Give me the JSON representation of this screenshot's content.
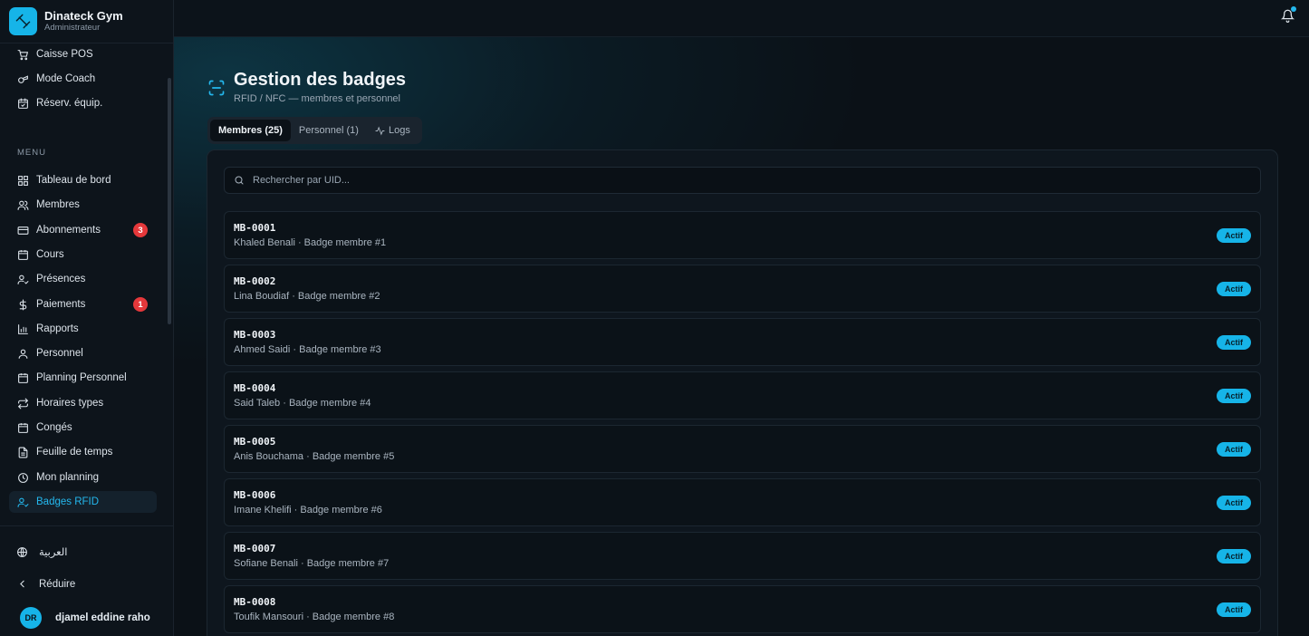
{
  "brand": {
    "name": "Dinateck Gym",
    "role": "Administrateur"
  },
  "sidebar": {
    "quick_items": [
      {
        "label": "Caisse POS",
        "icon": "cart-icon"
      },
      {
        "label": "Mode Coach",
        "icon": "whistle-icon"
      },
      {
        "label": "Réserv. équip.",
        "icon": "calendar-check-icon"
      }
    ],
    "menu_heading": "MENU",
    "items": [
      {
        "label": "Tableau de bord",
        "icon": "dashboard-icon"
      },
      {
        "label": "Membres",
        "icon": "users-icon"
      },
      {
        "label": "Abonnements",
        "icon": "card-icon",
        "badge": "3"
      },
      {
        "label": "Cours",
        "icon": "calendar-icon"
      },
      {
        "label": "Présences",
        "icon": "user-check-icon"
      },
      {
        "label": "Paiements",
        "icon": "dollar-icon",
        "badge": "1"
      },
      {
        "label": "Rapports",
        "icon": "bar-chart-icon"
      },
      {
        "label": "Personnel",
        "icon": "user-icon"
      },
      {
        "label": "Planning Personnel",
        "icon": "calendar-icon"
      },
      {
        "label": "Horaires types",
        "icon": "repeat-icon"
      },
      {
        "label": "Congés",
        "icon": "calendar-icon"
      },
      {
        "label": "Feuille de temps",
        "icon": "file-icon"
      },
      {
        "label": "Mon planning",
        "icon": "clock-icon"
      },
      {
        "label": "Badges RFID",
        "icon": "user-badge-icon",
        "active": true
      }
    ],
    "language_label": "العربية",
    "collapse_label": "Réduire",
    "user": {
      "initials": "DR",
      "name": "djamel eddine raho"
    }
  },
  "colors": {
    "accent": "#16b4e8",
    "badge_alert": "#e5383b",
    "background": "#0b1117"
  },
  "page": {
    "title": "Gestion des badges",
    "subtitle": "RFID / NFC — membres et personnel",
    "tabs": [
      {
        "label": "Membres (25)",
        "active": true
      },
      {
        "label": "Personnel (1)"
      },
      {
        "label": "Logs",
        "icon": "activity-icon"
      }
    ],
    "search": {
      "placeholder": "Rechercher par UID...",
      "value": ""
    },
    "badges": [
      {
        "code": "MB-0001",
        "desc": "Khaled Benali · Badge membre #1",
        "status": "Actif"
      },
      {
        "code": "MB-0002",
        "desc": "Lina Boudiaf · Badge membre #2",
        "status": "Actif"
      },
      {
        "code": "MB-0003",
        "desc": "Ahmed Saidi · Badge membre #3",
        "status": "Actif"
      },
      {
        "code": "MB-0004",
        "desc": "Said Taleb · Badge membre #4",
        "status": "Actif"
      },
      {
        "code": "MB-0005",
        "desc": "Anis Bouchama · Badge membre #5",
        "status": "Actif"
      },
      {
        "code": "MB-0006",
        "desc": "Imane Khelifi · Badge membre #6",
        "status": "Actif"
      },
      {
        "code": "MB-0007",
        "desc": "Sofiane Benali · Badge membre #7",
        "status": "Actif"
      },
      {
        "code": "MB-0008",
        "desc": "Toufik Mansouri · Badge membre #8",
        "status": "Actif"
      }
    ]
  }
}
